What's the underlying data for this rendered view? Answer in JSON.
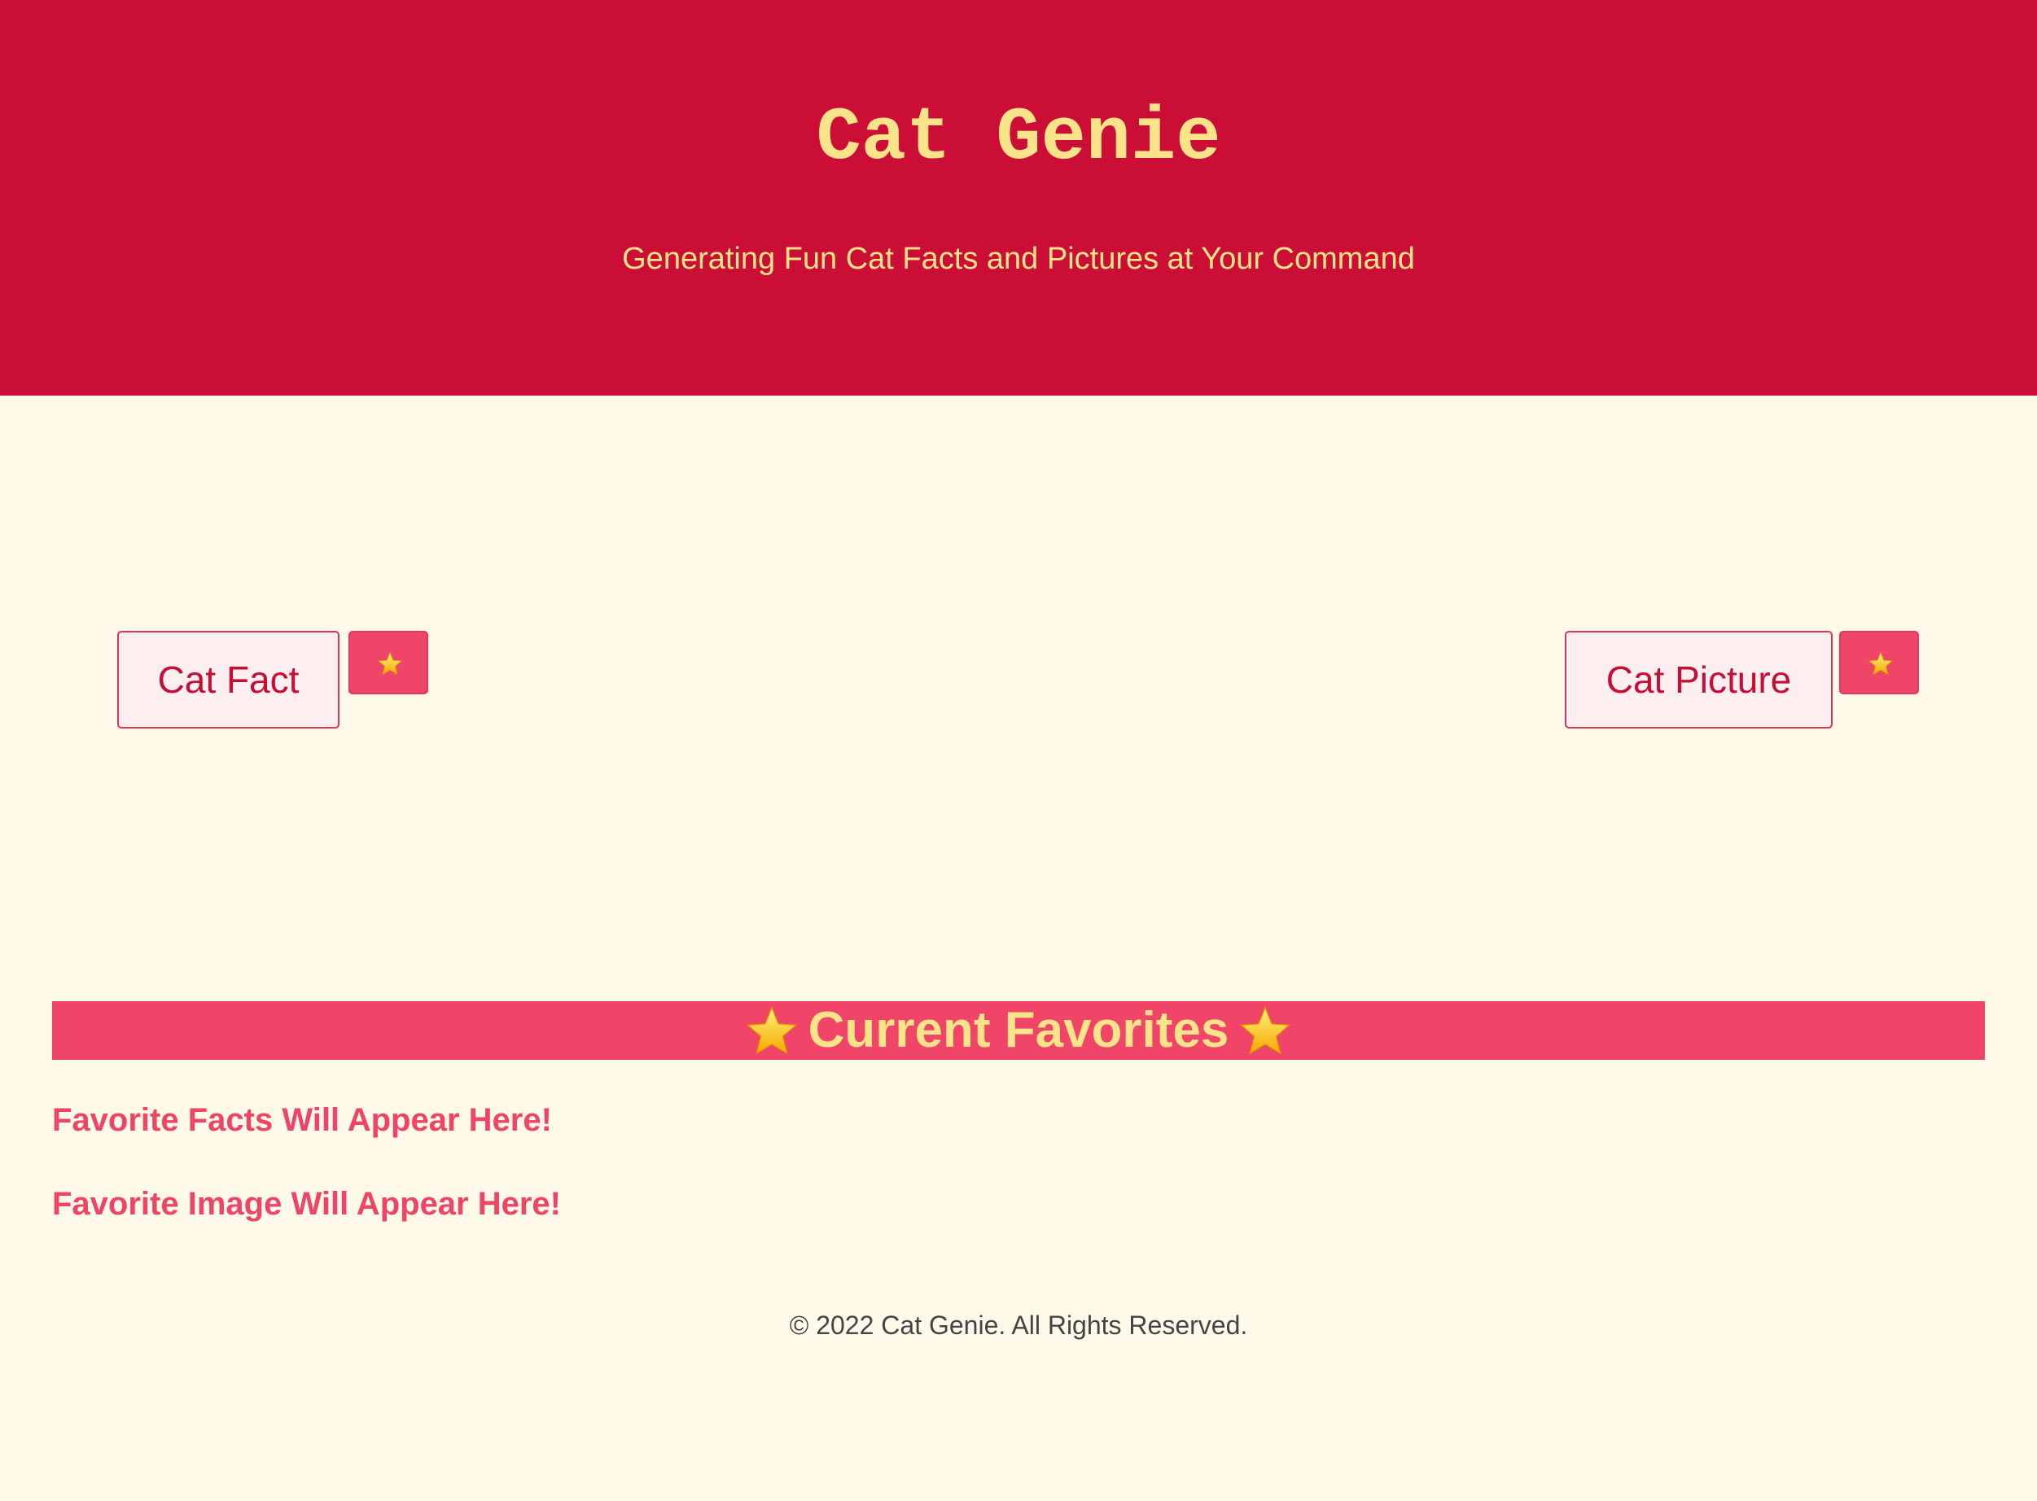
{
  "header": {
    "title": "Cat Genie",
    "subtitle": "Generating Fun Cat Facts and Pictures at Your Command"
  },
  "controls": {
    "fact_button_label": "Cat Fact",
    "fact_favorite_icon": "star-icon",
    "picture_button_label": "Cat Picture",
    "picture_favorite_icon": "star-icon"
  },
  "favorites": {
    "heading": "Current Favorites",
    "heading_icon": "star-icon",
    "facts_placeholder": "Favorite Facts Will Appear Here!",
    "image_placeholder": "Favorite Image Will Appear Here!"
  },
  "footer": {
    "copyright": "© 2022 Cat Genie. All Rights Reserved."
  },
  "colors": {
    "header_bg": "#cb0e35",
    "accent_yellow": "#fbe38a",
    "page_bg": "#fef9e8",
    "pink_accent": "#f04568",
    "button_bg": "#fdeef0"
  }
}
